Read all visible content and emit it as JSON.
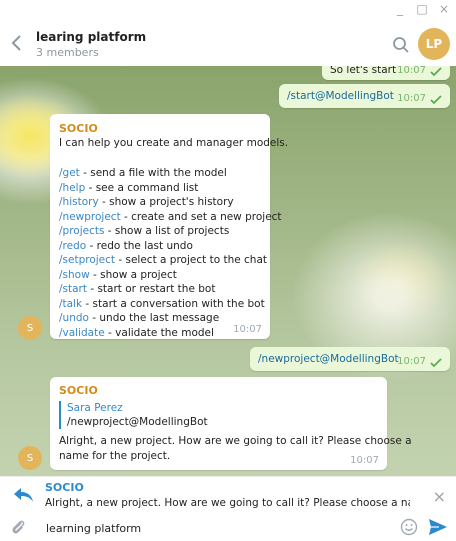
{
  "window": {
    "minimize_glyph": "_",
    "maximize_glyph": "□",
    "close_glyph": "×"
  },
  "header": {
    "title": "learing platform",
    "subtitle": "3 members",
    "avatar_initials": "LP",
    "back_icon": "chevron-left-icon",
    "search_icon": "search-icon"
  },
  "messages": {
    "m1": {
      "text": "So let's start",
      "time": "10:07"
    },
    "m2": {
      "text": "/start@ModellingBot",
      "time": "10:07"
    },
    "bot_help": {
      "sender": "SOCIO",
      "intro": "I can help you create and manager models.",
      "commands": [
        {
          "cmd": "/get",
          "desc": " - send a file with the model"
        },
        {
          "cmd": "/help",
          "desc": " - see a command list"
        },
        {
          "cmd": "/history",
          "desc": " - show a project's history"
        },
        {
          "cmd": "/newproject",
          "desc": " - create and set a new project"
        },
        {
          "cmd": "/projects",
          "desc": " - show a list of projects"
        },
        {
          "cmd": "/redo",
          "desc": " - redo the last undo"
        },
        {
          "cmd": "/setproject",
          "desc": " - select a project to the chat"
        },
        {
          "cmd": "/show",
          "desc": " - show a project"
        },
        {
          "cmd": "/start",
          "desc": " - start or restart the bot"
        },
        {
          "cmd": "/talk",
          "desc": " - start a conversation with the bot"
        },
        {
          "cmd": "/undo",
          "desc": " - undo the last message"
        },
        {
          "cmd": "/validate",
          "desc": " - validate the model"
        }
      ],
      "time": "10:07",
      "avatar": "S"
    },
    "m3": {
      "text": "/newproject@ModellingBot",
      "time": "10:07"
    },
    "bot_reply": {
      "sender": "SOCIO",
      "quote_name": "Sara Perez",
      "quote_text": "/newproject@ModellingBot",
      "text_line1": "Alright, a new project. How are we going to call it? Please choose a",
      "text_line2": "name for the project.",
      "time": "10:07",
      "avatar": "S"
    }
  },
  "reply_bar": {
    "sender": "SOCIO",
    "text": "Alright, a new project. How are we going to call it? Please choose a name for t..."
  },
  "composer": {
    "value": "learning platform"
  },
  "colors": {
    "accent": "#2a8ad0",
    "avatar": "#e3b55b",
    "sender": "#d38c19",
    "out_bubble": "#eaf8d9"
  }
}
